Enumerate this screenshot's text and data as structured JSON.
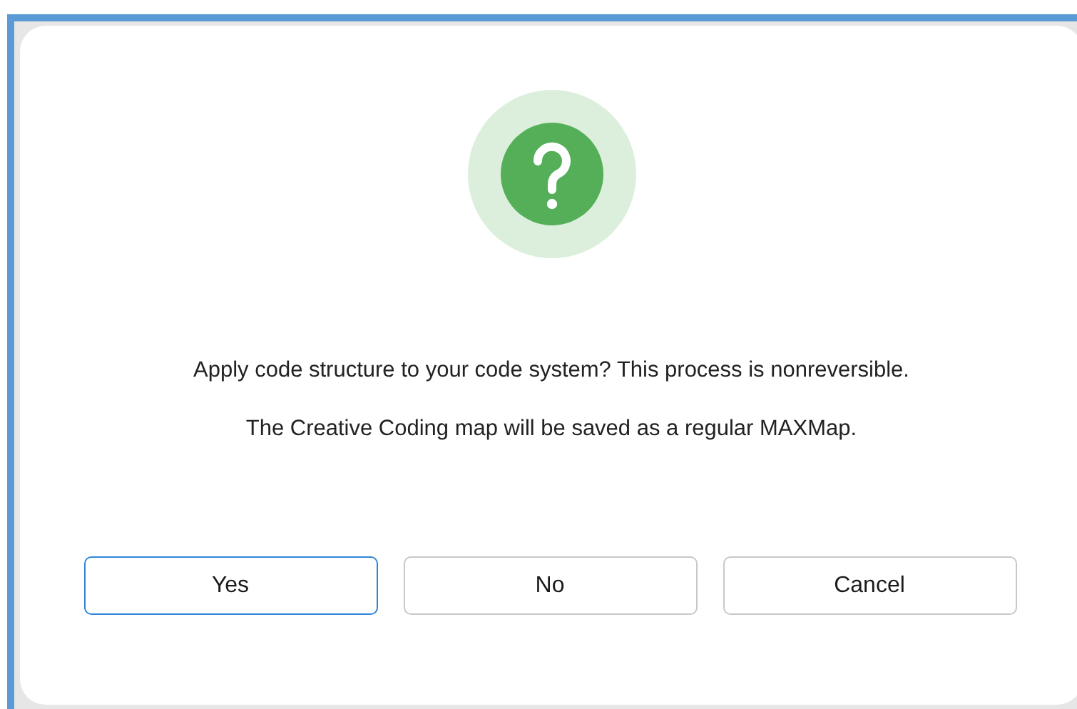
{
  "dialog": {
    "messages": [
      "Apply code structure to your code system? This process is nonreversible.",
      "The Creative Coding map will be saved as a regular MAXMap."
    ],
    "buttons": [
      {
        "label": "Yes",
        "focused": true
      },
      {
        "label": "No",
        "focused": false
      },
      {
        "label": "Cancel",
        "focused": false
      }
    ]
  }
}
